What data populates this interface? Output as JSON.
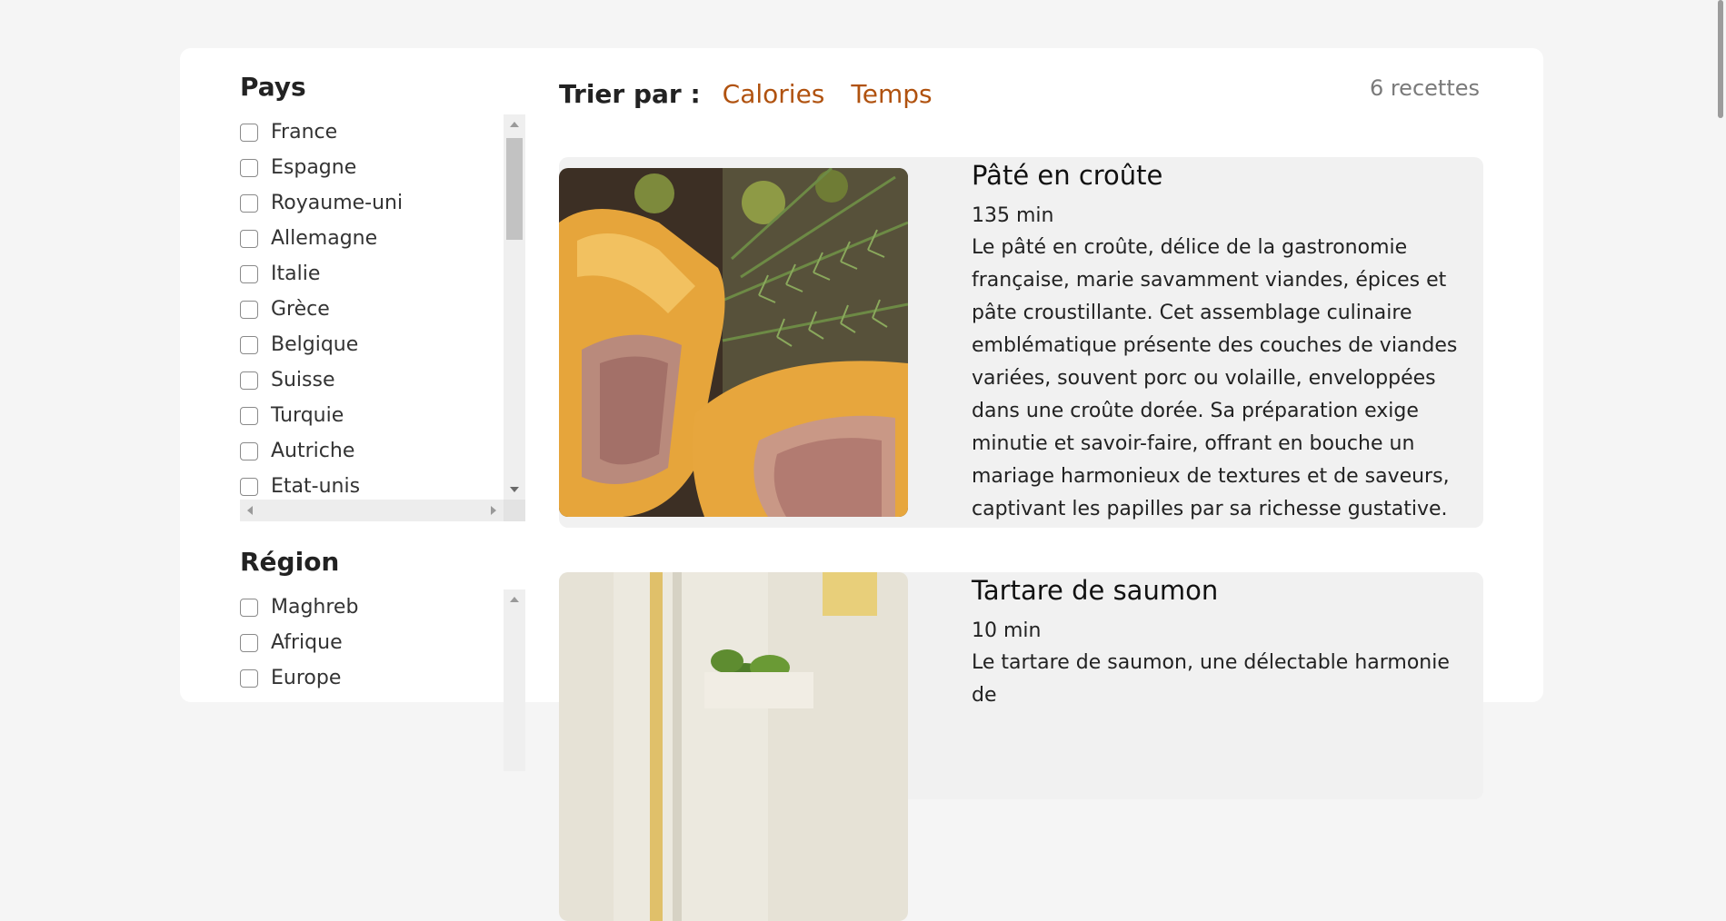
{
  "filters": {
    "pays": {
      "title": "Pays",
      "items": [
        "France",
        "Espagne",
        "Royaume-uni",
        "Allemagne",
        "Italie",
        "Grèce",
        "Belgique",
        "Suisse",
        "Turquie",
        "Autriche",
        "Etat-unis"
      ]
    },
    "region": {
      "title": "Région",
      "items": [
        "Maghreb",
        "Afrique",
        "Europe"
      ]
    }
  },
  "sort": {
    "label": "Trier par :",
    "options": [
      "Calories",
      "Temps"
    ],
    "accent_color": "#b0520f"
  },
  "results": {
    "count_label": "6 recettes"
  },
  "recipes": [
    {
      "title": "Pâté en croûte",
      "time": "135 min",
      "description": "Le pâté en croûte, délice de la gastronomie française, marie savamment viandes, épices et pâte croustillante. Cet assemblage culinaire emblématique présente des couches de viandes variées, souvent porc ou volaille, enveloppées dans une croûte dorée. Sa préparation exige minutie et savoir-faire, offrant en bouche un mariage harmonieux de textures et de saveurs, captivant les papilles par sa richesse gustative."
    },
    {
      "title": "Tartare de saumon",
      "time": "10 min",
      "description": "Le tartare de saumon, une délectable harmonie de"
    }
  ]
}
